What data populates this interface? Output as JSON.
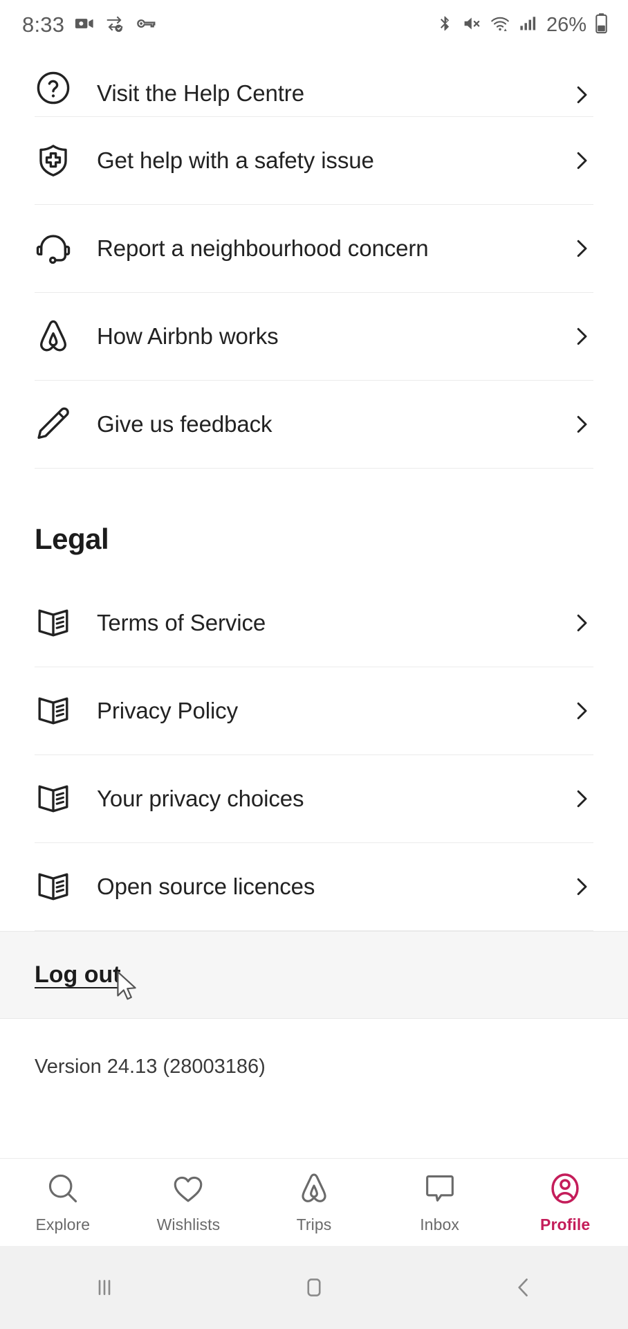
{
  "status_bar": {
    "time": "8:33",
    "battery_percent": "26%",
    "left_icons": [
      "camera-recording-icon",
      "data-saver-icon",
      "vpn-key-icon"
    ],
    "right_icons": [
      "bluetooth-icon",
      "mute-icon",
      "wifi-icon",
      "cellular-signal-icon",
      "battery-icon"
    ]
  },
  "support_section": {
    "items": [
      {
        "label": "Visit the Help Centre",
        "icon": "question-circle-icon"
      },
      {
        "label": "Get help with a safety issue",
        "icon": "shield-cross-icon"
      },
      {
        "label": "Report a neighbourhood concern",
        "icon": "headset-icon"
      },
      {
        "label": "How Airbnb works",
        "icon": "airbnb-logo-icon"
      },
      {
        "label": "Give us feedback",
        "icon": "pencil-icon"
      }
    ]
  },
  "legal_section": {
    "heading": "Legal",
    "items": [
      {
        "label": "Terms of Service",
        "icon": "document-book-icon"
      },
      {
        "label": "Privacy Policy",
        "icon": "document-book-icon"
      },
      {
        "label": "Your privacy choices",
        "icon": "document-book-icon"
      },
      {
        "label": "Open source licences",
        "icon": "document-book-icon"
      }
    ]
  },
  "logout": {
    "label": "Log out"
  },
  "version": {
    "text": "Version 24.13 (28003186)"
  },
  "tab_bar": {
    "tabs": [
      {
        "label": "Explore",
        "icon": "search-icon",
        "active": false
      },
      {
        "label": "Wishlists",
        "icon": "heart-icon",
        "active": false
      },
      {
        "label": "Trips",
        "icon": "airbnb-logo-icon",
        "active": false
      },
      {
        "label": "Inbox",
        "icon": "chat-bubble-icon",
        "active": false
      },
      {
        "label": "Profile",
        "icon": "user-circle-icon",
        "active": true
      }
    ],
    "active_color": "#c41d5a",
    "inactive_color": "#6a6a6a"
  },
  "android_nav": {
    "buttons": [
      "recents-icon",
      "home-icon",
      "back-icon"
    ]
  }
}
